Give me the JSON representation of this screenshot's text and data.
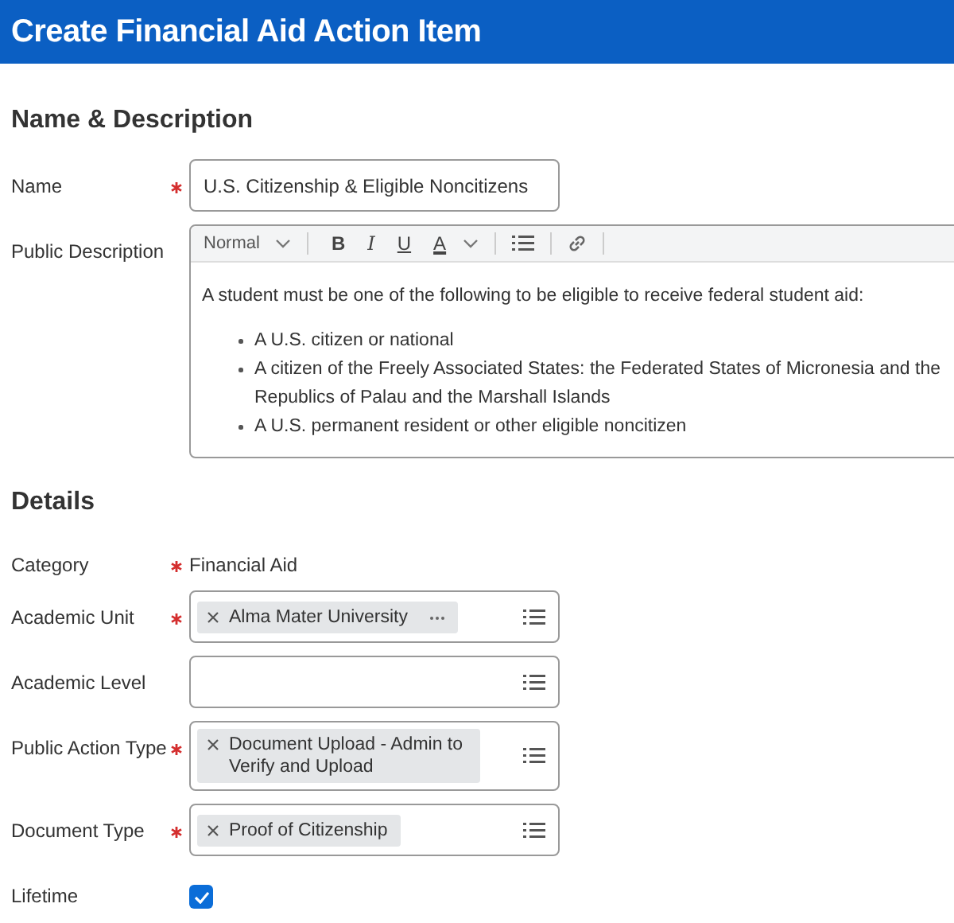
{
  "header": {
    "title": "Create Financial Aid Action Item"
  },
  "sections": [
    {
      "title": "Name & Description",
      "fields": [
        {
          "kind": "text",
          "label": "Name",
          "required": true,
          "value": "U.S. Citizenship & Eligible Noncitizens"
        },
        {
          "kind": "richtext",
          "label": "Public Description",
          "required": false,
          "toolbar": {
            "style": "Normal",
            "buttons": [
              "B",
              "I",
              "U",
              "A"
            ]
          },
          "paragraph": "A student must be one of the following to be eligible to receive federal student aid:",
          "bullets": [
            "A U.S. citizen or national",
            "A citizen of the Freely Associated States: the Federated States of Micronesia and the Republics of Palau and the Marshall Islands",
            "A U.S. permanent resident or other eligible noncitizen"
          ]
        }
      ]
    },
    {
      "title": "Details",
      "fields": [
        {
          "kind": "static",
          "label": "Category",
          "required": true,
          "value": "Financial Aid"
        },
        {
          "kind": "multiselect",
          "label": "Academic Unit",
          "required": true,
          "chips": [
            {
              "text": "Alma Mater University",
              "more": true
            }
          ]
        },
        {
          "kind": "multiselect",
          "label": "Academic Level",
          "required": false
        },
        {
          "kind": "multiselect",
          "label": "Public Action Type",
          "required": true,
          "chips": [
            {
              "text": "Document Upload - Admin to Verify and Upload",
              "more": false
            }
          ]
        },
        {
          "kind": "multiselect",
          "label": "Document Type",
          "required": true,
          "chips": [
            {
              "text": "Proof of Citizenship",
              "more": false
            }
          ]
        },
        {
          "kind": "checkbox",
          "label": "Lifetime",
          "required": false,
          "checked": true
        }
      ]
    }
  ]
}
